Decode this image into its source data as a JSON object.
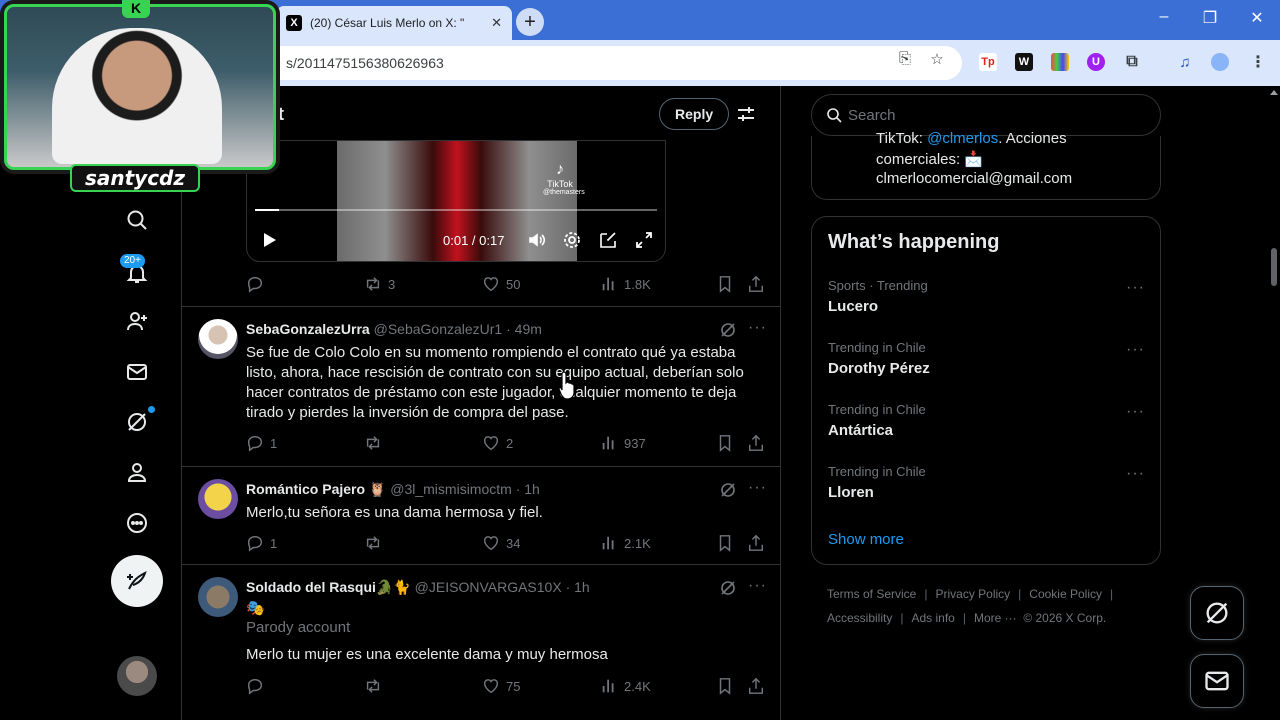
{
  "browser": {
    "tab_title": "(20) César Luis Merlo on X: \"",
    "tab_favicon": "X",
    "url": "s/2011475156380626963",
    "window_controls": [
      "–",
      "❐",
      "✕"
    ]
  },
  "overlay": {
    "streamer_name": "santycdz",
    "logo": "K"
  },
  "nav": {
    "notifications_badge": "20+"
  },
  "header": {
    "title": "st",
    "reply_label": "Reply"
  },
  "video": {
    "time": "0:01 / 0:17",
    "progress": 0.06,
    "watermark": "TikTok",
    "watermark_handle": "@themasters"
  },
  "main_post_actions": {
    "replies": "",
    "reposts": "3",
    "likes": "50",
    "views": "1.8K"
  },
  "posts": [
    {
      "display_name": "SebaGonzalezUrra",
      "handle": "@SebaGonzalezUr1",
      "time": "· 49m",
      "text": "Se fue de Colo Colo en su momento rompiendo el contrato qué ya estaba listo, ahora, hace rescisión de contrato con su equipo actual, deberían solo hacer contratos de préstamo con este jugador, cualquier momento te deja tirado y pierdes la inversión de compra del pase.",
      "replies": "1",
      "reposts": "",
      "likes": "2",
      "views": "937"
    },
    {
      "display_name": "Romántico Pajero 🦉",
      "handle": "@3l_mismisimoctm",
      "time": "· 1h",
      "text": "Merlo,tu señora es una dama hermosa y fiel.",
      "replies": "1",
      "reposts": "",
      "likes": "34",
      "views": "2.1K"
    },
    {
      "display_name": "Soldado del Rasqui🐊🐈",
      "handle": "@JEISONVARGAS10X",
      "time": "· 1h",
      "emoji_line": "🎭",
      "parody": "Parody account",
      "text": "Merlo tu mujer es una excelente dama y muy hermosa",
      "replies": "",
      "reposts": "",
      "likes": "75",
      "views": "2.4K"
    }
  ],
  "sidebar": {
    "search_placeholder": "Search",
    "bio_line1_prefix": "TikTok: ",
    "bio_line1_link": "@clmerlos",
    "bio_line1_suffix": ". Acciones",
    "bio_line2": "comerciales: 📩",
    "bio_line3": "clmerlocomercial@gmail.com",
    "happening_title": "What’s happening",
    "trends": [
      {
        "meta": "Sports · Trending",
        "name": "Lucero"
      },
      {
        "meta": "Trending in Chile",
        "name": "Dorothy Pérez"
      },
      {
        "meta": "Trending in Chile",
        "name": "Antártica"
      },
      {
        "meta": "Trending in Chile",
        "name": "Lloren"
      }
    ],
    "show_more": "Show more",
    "footer": {
      "terms": "Terms of Service",
      "privacy": "Privacy Policy",
      "cookie": "Cookie Policy",
      "accessibility": "Accessibility",
      "ads": "Ads info",
      "more": "More ···",
      "copyright": "© 2026 X Corp."
    }
  },
  "colors": {
    "accent": "#1d9bf0",
    "overlay_green": "#39d353",
    "browser_tabbar": "#3b6fd6"
  }
}
